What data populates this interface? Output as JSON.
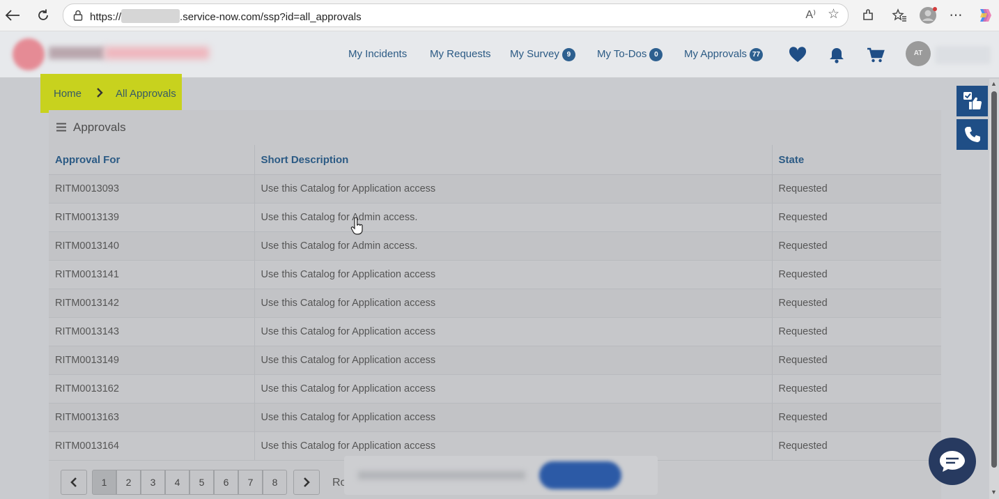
{
  "browser": {
    "url_prefix": "https://",
    "url_suffix": ".service-now.com/ssp?id=all_approvals",
    "read_aloud_label": "A⁾"
  },
  "nav": {
    "incidents": "My Incidents",
    "requests": "My Requests",
    "survey": "My Survey",
    "survey_count": "9",
    "todos": "My To-Dos",
    "todos_count": "0",
    "approvals": "My Approvals",
    "approvals_count": "77",
    "avatar_initials": "AT"
  },
  "breadcrumb": {
    "home": "Home",
    "current": "All Approvals"
  },
  "panel": {
    "title": "Approvals",
    "columns": [
      "Approval For",
      "Short Description",
      "State"
    ],
    "rows": [
      {
        "id": "RITM0013093",
        "desc": "Use this Catalog for Application access",
        "state": "Requested"
      },
      {
        "id": "RITM0013139",
        "desc": "Use this Catalog for Admin access.",
        "state": "Requested"
      },
      {
        "id": "RITM0013140",
        "desc": "Use this Catalog for Admin access.",
        "state": "Requested"
      },
      {
        "id": "RITM0013141",
        "desc": "Use this Catalog for Application access",
        "state": "Requested"
      },
      {
        "id": "RITM0013142",
        "desc": "Use this Catalog for Application access",
        "state": "Requested"
      },
      {
        "id": "RITM0013143",
        "desc": "Use this Catalog for Application access",
        "state": "Requested"
      },
      {
        "id": "RITM0013149",
        "desc": "Use this Catalog for Application access",
        "state": "Requested"
      },
      {
        "id": "RITM0013162",
        "desc": "Use this Catalog for Application access",
        "state": "Requested"
      },
      {
        "id": "RITM0013163",
        "desc": "Use this Catalog for Application access",
        "state": "Requested"
      },
      {
        "id": "RITM0013164",
        "desc": "Use this Catalog for Application access",
        "state": "Requested"
      }
    ]
  },
  "pagination": {
    "pages": [
      "1",
      "2",
      "3",
      "4",
      "5",
      "6",
      "7",
      "8"
    ],
    "active_page": "1",
    "prev_icon": "chevron-left-icon",
    "next_icon": "chevron-right-icon",
    "rows_label_partial": "Ro"
  },
  "colors": {
    "nav_text": "#2b5a84",
    "badge": "#2d5f8f",
    "breadcrumb_highlight": "#c8d21e",
    "side_button": "#1f4e86",
    "chat_button": "#273a60"
  }
}
